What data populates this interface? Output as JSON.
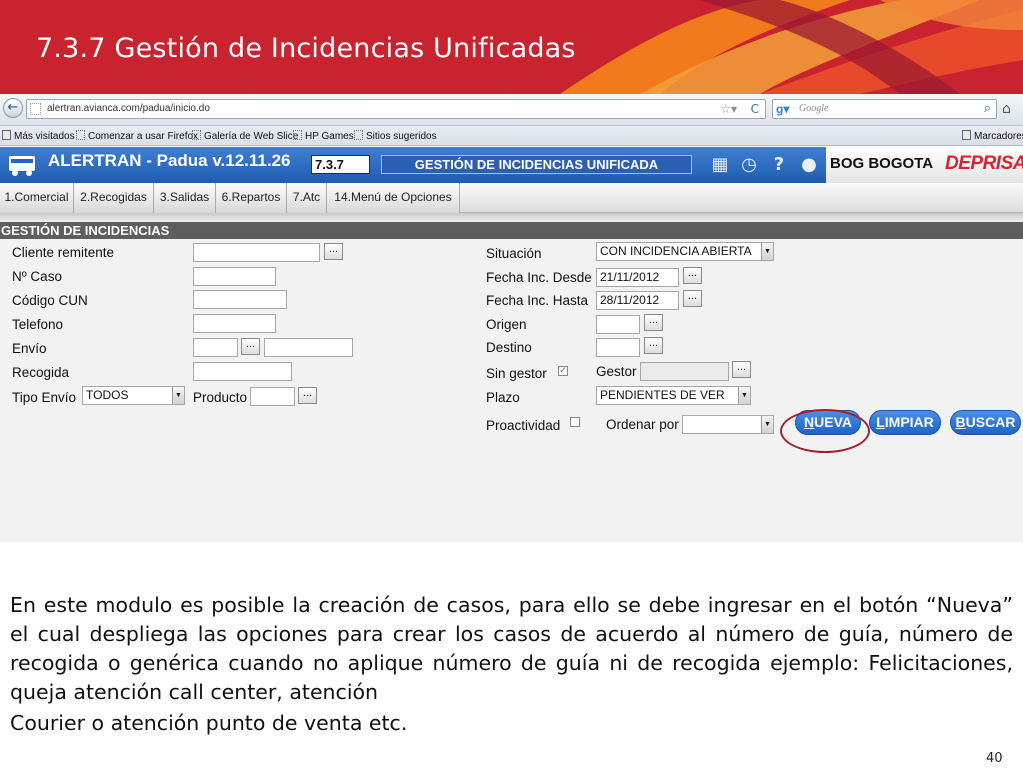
{
  "slide": {
    "title": "7.3.7 Gestión de Incidencias Unificadas",
    "page_number": "40",
    "body_text_main": "En este modulo es posible la creación de casos, para ello se debe ingresar en el botón “Nueva” el cual despliega las opciones para crear los casos de acuerdo al número de guía, número de recogida o genérica cuando no aplique número de guía ni de recogida ejemplo: Felicitaciones, queja atención call center, atención",
    "body_text_last": "Courier o atención punto de venta etc.",
    "colors": {
      "banner_red": "#c8232f",
      "banner_orange": "#f07a1c",
      "app_blue": "#2a64b8",
      "highlight_ring": "#a2202f"
    }
  },
  "browser": {
    "url": "alertran.avianca.com/padua/inicio.do",
    "search_placeholder": "Google",
    "back_icon": "back-arrow-icon",
    "bookmarks": [
      "Más visitados",
      "Comenzar a usar Firefox",
      "Galería de Web Slice",
      "HP Games",
      "Sitios sugeridos"
    ],
    "bookmarks_right": "Marcadores"
  },
  "app": {
    "name": "ALERTRAN - Padua  v.12.11.26",
    "code": "7.3.7",
    "module": "GESTIÓN DE INCIDENCIAS UNIFICADA",
    "user": "BOG BOGOTA",
    "brand": "DEPRISA",
    "header_icons": [
      "calendar-icon",
      "clock-icon",
      "help-icon",
      "user-icon"
    ]
  },
  "tabs": [
    "1.Comercial",
    "2.Recogidas",
    "3.Salidas",
    "6.Repartos",
    "7.Atc",
    "14.Menú de Opciones"
  ],
  "form": {
    "section_title": "GESTIÓN DE INCIDENCIAS",
    "left_labels": {
      "cliente": "Cliente remitente",
      "caso": "Nº Caso",
      "cun": "Código CUN",
      "telefono": "Telefono",
      "envio": "Envío",
      "recogida": "Recogida",
      "tipo_envio": "Tipo Envío",
      "producto": "Producto"
    },
    "tipo_envio_value": "TODOS",
    "right_labels": {
      "situacion": "Situación",
      "fecha_desde": "Fecha Inc. Desde",
      "fecha_hasta": "Fecha Inc. Hasta",
      "origen": "Origen",
      "destino": "Destino",
      "sin_gestor": "Sin gestor",
      "gestor": "Gestor",
      "plazo": "Plazo",
      "proactividad": "Proactividad",
      "ordenar": "Ordenar por"
    },
    "situacion_value": "CON INCIDENCIA ABIERTA",
    "fecha_desde_value": "21/11/2012",
    "fecha_hasta_value": "28/11/2012",
    "plazo_value": "PENDIENTES DE VER",
    "sin_gestor_checked": true,
    "proactividad_checked": false,
    "ellipsis": "...",
    "buttons": {
      "nueva_key": "N",
      "nueva_rest": "UEVA",
      "limpiar_key": "L",
      "limpiar_rest": "IMPIAR",
      "buscar_key": "B",
      "buscar_rest": "USCAR"
    }
  }
}
